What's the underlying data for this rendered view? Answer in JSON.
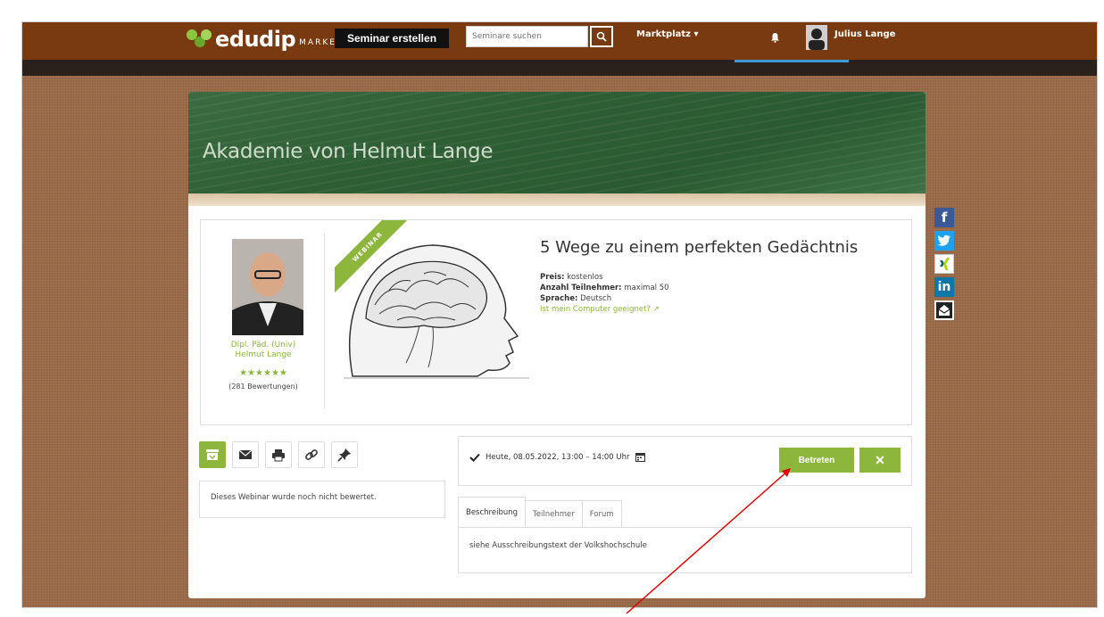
{
  "header": {
    "logo_text": "edudip",
    "logo_sub": "MARKET",
    "create_label": "Seminar erstellen",
    "search_placeholder": "Seminare suchen",
    "marketplace_label": "Marktplatz ▾",
    "username": "Julius Lange"
  },
  "banner": {
    "title": "Akademie von Helmut Lange"
  },
  "author": {
    "name_line1": "Dipl. Päd. (Univ)",
    "name_line2": "Helmut Lange",
    "stars": "★★★★★★",
    "reviews": "(281 Bewertungen)"
  },
  "seminar": {
    "ribbon": "WEBINAR",
    "title": "5 Wege zu einem perfekten Gedächtnis",
    "price_label": "Preis:",
    "price_value": "kostenlos",
    "participants_label": "Anzahl Teilnehmer:",
    "participants_value": "maximal 50",
    "language_label": "Sprache:",
    "language_value": "Deutsch",
    "computer_check": "Ist mein Computer geeignet?"
  },
  "rating": {
    "text": "Dieses Webinar wurde noch nicht bewertet."
  },
  "schedule": {
    "date_text": "Heute, 08.05.2022, 13:00 – 14:00 Uhr",
    "join_label": "Betreten",
    "cancel_label": "✕"
  },
  "tabs": [
    {
      "label": "Beschreibung"
    },
    {
      "label": "Teilnehmer"
    },
    {
      "label": "Forum"
    }
  ],
  "description": {
    "text": "siehe Ausschreibungstext der Volkshochschule"
  },
  "share": {
    "facebook": "f",
    "twitter": "twitter-icon",
    "xing": "xing-icon",
    "linkedin": "in",
    "email": "email-icon"
  },
  "colors": {
    "accent": "#8cb63c",
    "topbar": "#7a3a10",
    "facebook": "#3b5998",
    "twitter": "#1da1f2",
    "linkedin": "#0e76a8",
    "annotation_arrow": "#e00000"
  }
}
